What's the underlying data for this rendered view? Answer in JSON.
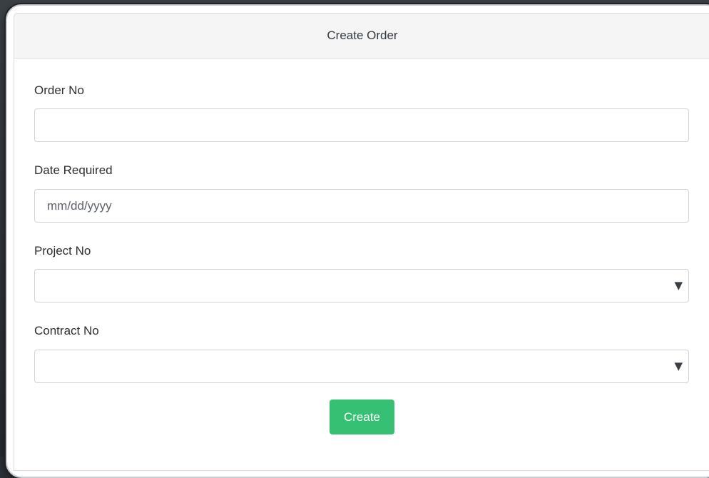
{
  "form": {
    "title": "Create Order",
    "fields": [
      {
        "label": "Order No",
        "type": "text",
        "value": "",
        "placeholder": ""
      },
      {
        "label": "Date Required",
        "type": "date",
        "value": "",
        "placeholder": "mm/dd/yyyy"
      },
      {
        "label": "Project No",
        "type": "select",
        "value": "",
        "caret": "▼"
      },
      {
        "label": "Contract No",
        "type": "select",
        "value": "",
        "caret": "▼"
      }
    ],
    "submit_label": "Create"
  },
  "icons": {
    "select_caret": "caret-down-icon"
  },
  "colors": {
    "primary_button": "#36c074",
    "header_background": "#f5f5f5",
    "backdrop": "#2b3138"
  }
}
